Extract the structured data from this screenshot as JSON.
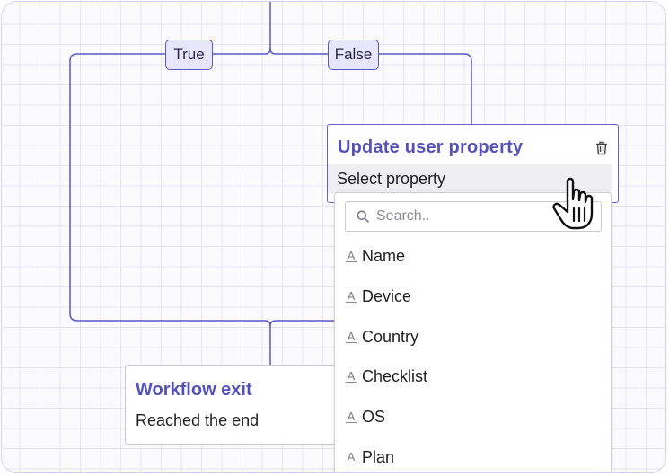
{
  "canvas": {
    "branches": {
      "true_label": "True",
      "false_label": "False"
    }
  },
  "update_card": {
    "title": "Update user property",
    "delete_icon": "trash-icon",
    "select_label": "Select property"
  },
  "dropdown": {
    "search_placeholder": "Search..",
    "search_icon": "search-icon",
    "option_icon": "text-type-icon",
    "options": [
      "Name",
      "Device",
      "Country",
      "Checklist",
      "OS",
      "Plan"
    ]
  },
  "exit_card": {
    "title": "Workflow exit",
    "subtitle": "Reached the end"
  },
  "colors": {
    "accent": "#5452b8",
    "wire": "#5b57c4",
    "branch_bg": "#e7e6fb",
    "grid": "#e4e4f4"
  }
}
